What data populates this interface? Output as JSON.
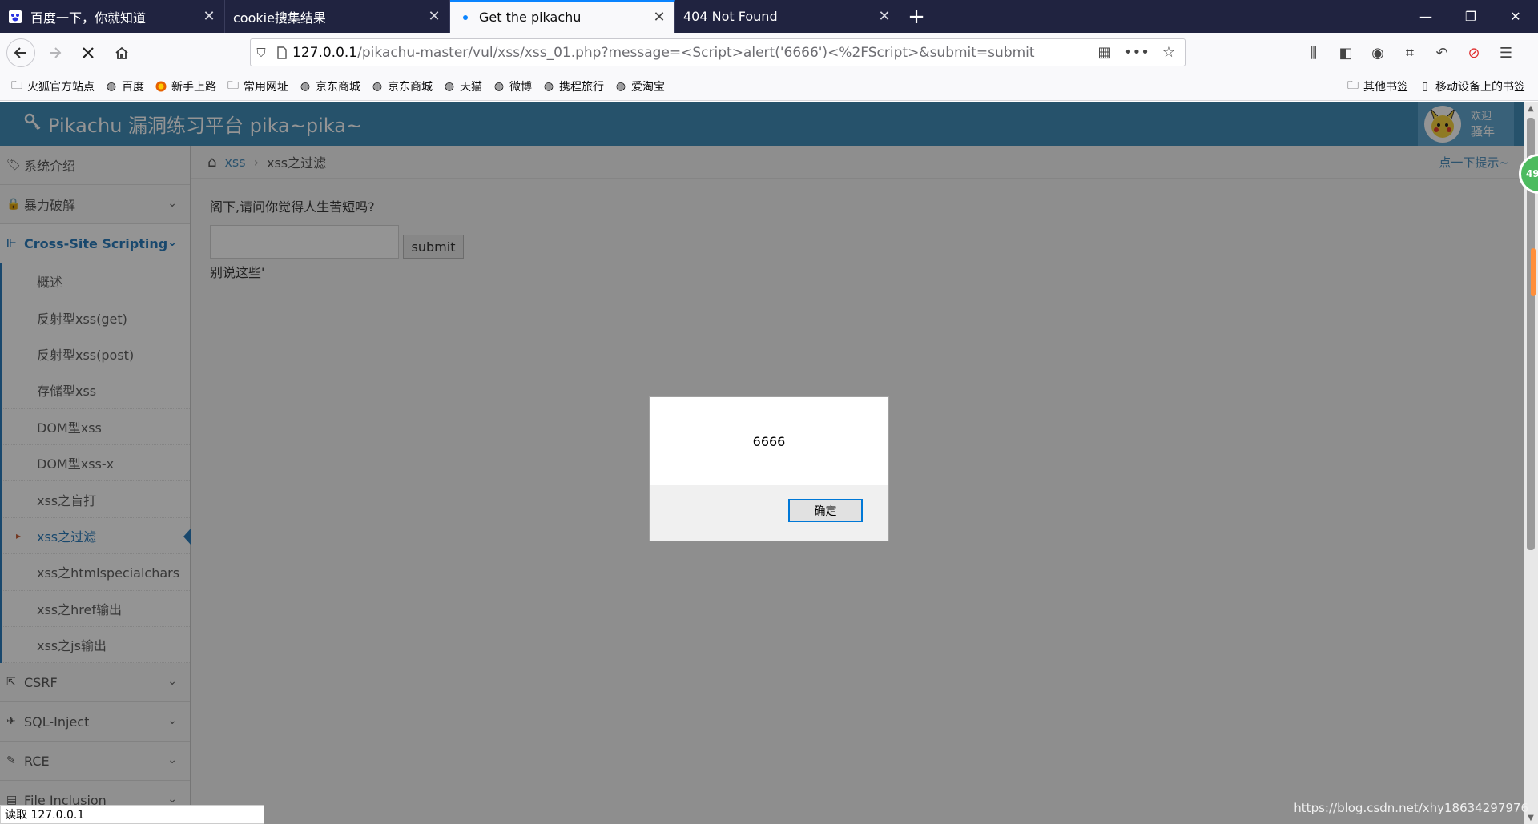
{
  "browser": {
    "tabs": [
      {
        "label": "百度一下，你就知道",
        "active": false
      },
      {
        "label": "cookie搜集结果",
        "active": false
      },
      {
        "label": "Get the pikachu",
        "active": true
      },
      {
        "label": "404 Not Found",
        "active": false
      }
    ],
    "url_host": "127.0.0.1",
    "url_rest": "/pikachu-master/vul/xss/xss_01.php?message=<Script>alert('6666')<%2FScript>&submit=submit",
    "bookmarks": [
      "火狐官方站点",
      "百度",
      "新手上路",
      "常用网址",
      "京东商城",
      "京东商城",
      "天猫",
      "微博",
      "携程旅行",
      "爱淘宝"
    ],
    "bookmarks_right": [
      "其他书签",
      "移动设备上的书签"
    ],
    "status_text": "读取 127.0.0.1"
  },
  "site": {
    "title": "Pikachu 漏洞练习平台 pika~pika~",
    "welcome": "欢迎",
    "user_name": "骚年"
  },
  "sidebar": {
    "items": [
      {
        "label": "系统介绍"
      },
      {
        "label": "暴力破解"
      },
      {
        "label": "Cross-Site Scripting"
      },
      {
        "label": "CSRF"
      },
      {
        "label": "SQL-Inject"
      },
      {
        "label": "RCE"
      },
      {
        "label": "File Inclusion"
      }
    ],
    "xss_submenu": [
      "概述",
      "反射型xss(get)",
      "反射型xss(post)",
      "存储型xss",
      "DOM型xss",
      "DOM型xss-x",
      "xss之盲打",
      "xss之过滤",
      "xss之htmlspecialchars",
      "xss之href输出",
      "xss之js输出"
    ],
    "active_submenu": "xss之过滤"
  },
  "breadcrumb": {
    "link": "xss",
    "current": "xss之过滤",
    "hint": "点一下提示~"
  },
  "content": {
    "question": "阁下,请问你觉得人生苦短吗?",
    "input_value": "",
    "submit_label": "submit",
    "result": "别说这些'"
  },
  "dialog": {
    "message": "6666",
    "ok_label": "确定"
  },
  "badge_text": "49",
  "watermark": "https://blog.csdn.net/xhy18634297976",
  "colors": {
    "header": "#438eb9",
    "accent": "#2b7dbc",
    "tabbar": "#202340"
  }
}
